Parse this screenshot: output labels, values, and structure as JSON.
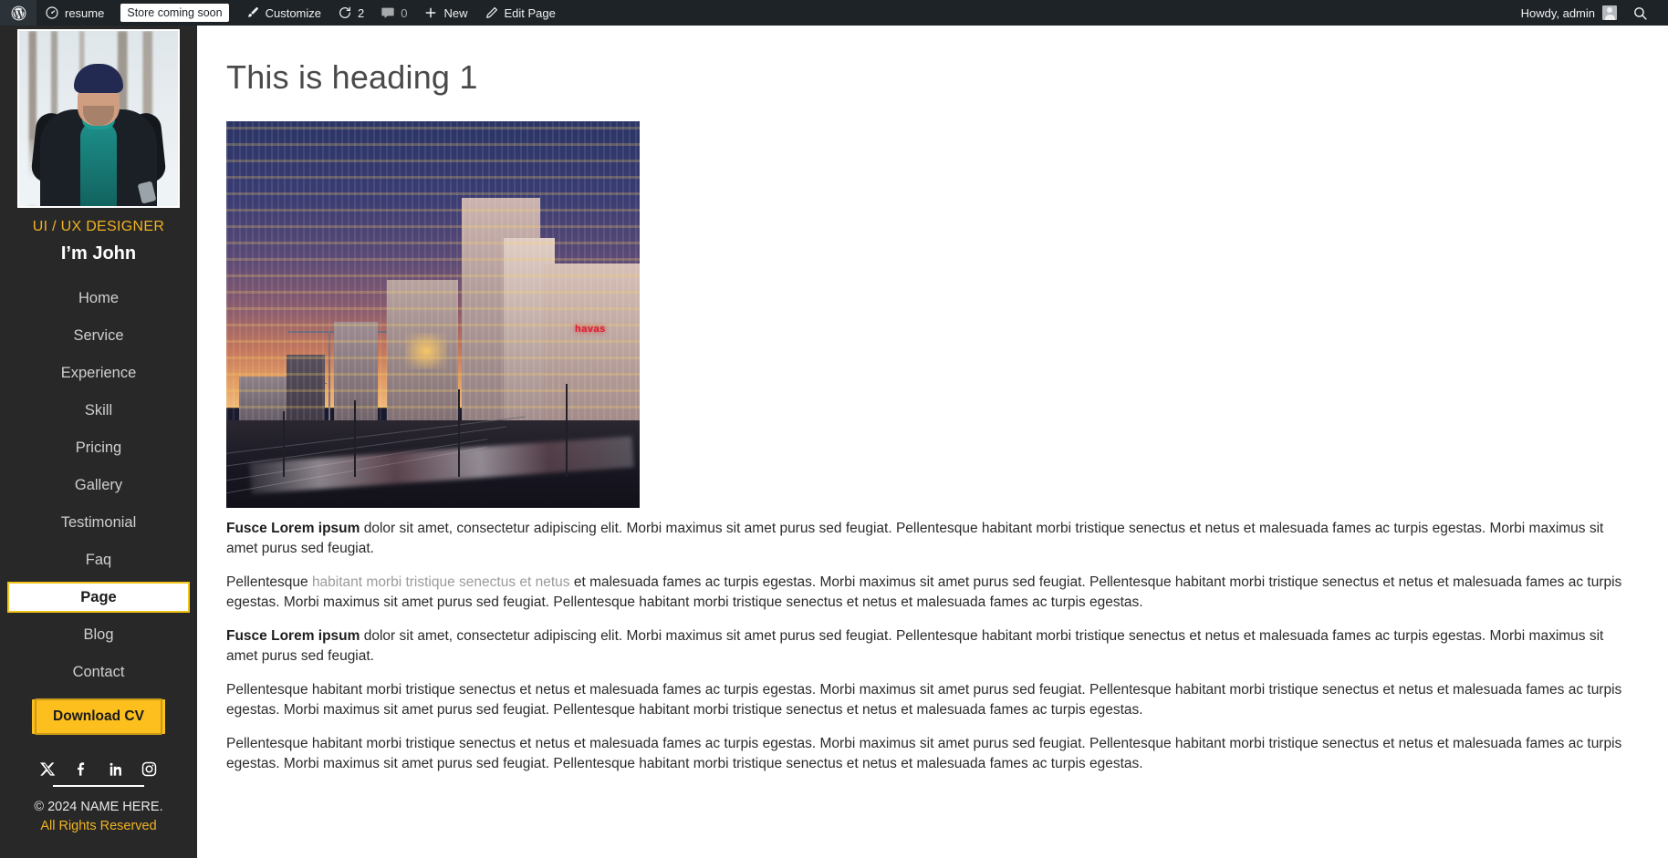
{
  "admin_bar": {
    "logo_icon": "wordpress-logo-icon",
    "site_name": "resume",
    "store_badge": "Store coming soon",
    "customize_icon": "paintbrush-icon",
    "customize_label": "Customize",
    "updates_icon": "updates-icon",
    "updates_count": "2",
    "comments_icon": "comment-bubble-icon",
    "comments_count": "0",
    "new_icon": "plus-icon",
    "new_label": "New",
    "edit_icon": "pencil-icon",
    "edit_label": "Edit Page",
    "howdy": "Howdy, admin",
    "avatar_icon": "user-avatar-icon",
    "search_icon": "search-icon"
  },
  "sidebar": {
    "avatar_icon": "profile-photo",
    "role": "UI / UX DESIGNER",
    "name": "I’m John",
    "nav": [
      {
        "label": "Home",
        "active": false
      },
      {
        "label": "Service",
        "active": false
      },
      {
        "label": "Experience",
        "active": false
      },
      {
        "label": "Skill",
        "active": false
      },
      {
        "label": "Pricing",
        "active": false
      },
      {
        "label": "Gallery",
        "active": false
      },
      {
        "label": "Testimonial",
        "active": false
      },
      {
        "label": "Faq",
        "active": false
      },
      {
        "label": "Page",
        "active": true
      },
      {
        "label": "Blog",
        "active": false
      },
      {
        "label": "Contact",
        "active": false
      }
    ],
    "cta_label": "Download CV",
    "socials": [
      {
        "name": "x-twitter-icon",
        "label": "X"
      },
      {
        "name": "facebook-icon",
        "label": "Facebook"
      },
      {
        "name": "linkedin-icon",
        "label": "LinkedIn"
      },
      {
        "name": "instagram-icon",
        "label": "Instagram"
      }
    ],
    "copyright": "© 2024 NAME HERE.",
    "rights": "All Rights Reserved"
  },
  "main": {
    "title": "This is heading 1",
    "image_alt": "City skyline at dusk with railway tracks and a passing train",
    "image_sign_text": "havas",
    "paragraphs": [
      {
        "lead": "Fusce Lorem ipsum",
        "rest": " dolor sit amet, consectetur adipiscing elit. Morbi maximus sit amet purus sed feugiat. Pellentesque habitant morbi tristique senectus et netus et malesuada fames ac turpis egestas. Morbi maximus sit amet purus sed feugiat."
      },
      {
        "pre": "Pellentesque ",
        "link": "habitant morbi tristique senectus et netus",
        "post": " et malesuada fames ac turpis egestas. Morbi maximus sit amet purus sed feugiat. Pellentesque habitant morbi tristique senectus et netus et malesuada fames ac turpis egestas. Morbi maximus sit amet purus sed feugiat. Pellentesque habitant morbi tristique senectus et netus et malesuada fames ac turpis egestas."
      },
      {
        "lead": "Fusce Lorem ipsum",
        "rest": " dolor sit amet, consectetur adipiscing elit. Morbi maximus sit amet purus sed feugiat. Pellentesque habitant morbi tristique senectus et netus et malesuada fames ac turpis egestas. Morbi maximus sit amet purus sed feugiat."
      },
      {
        "text": "Pellentesque habitant morbi tristique senectus et netus et malesuada fames ac turpis egestas. Morbi maximus sit amet purus sed feugiat. Pellentesque habitant morbi tristique senectus et netus et malesuada fames ac turpis egestas. Morbi maximus sit amet purus sed feugiat. Pellentesque habitant morbi tristique senectus et netus et malesuada fames ac turpis egestas."
      },
      {
        "text": "Pellentesque habitant morbi tristique senectus et netus et malesuada fames ac turpis egestas. Morbi maximus sit amet purus sed feugiat. Pellentesque habitant morbi tristique senectus et netus et malesuada fames ac turpis egestas. Morbi maximus sit amet purus sed feugiat. Pellentesque habitant morbi tristique senectus et netus et malesuada fames ac turpis egestas."
      }
    ]
  },
  "colors": {
    "admin_bar_bg": "#1d2327",
    "sidebar_bg": "#282828",
    "accent_gold": "#f0b323",
    "cta_bg": "#fcbf1e",
    "body_text": "#2b2b2b",
    "link_gray": "#9b9b9b"
  }
}
